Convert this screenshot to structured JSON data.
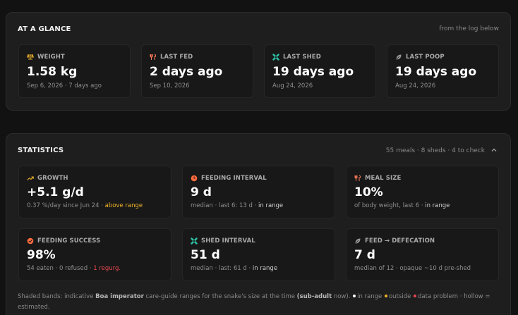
{
  "glance": {
    "title": "AT A GLANCE",
    "note": "from the log below",
    "cards": [
      {
        "icon": "scale-icon",
        "label": "WEIGHT",
        "value": "1.58 kg",
        "sub": "Sep 6, 2026 · 7 days ago"
      },
      {
        "icon": "fork-knife-icon",
        "label": "LAST FED",
        "value": "2 days ago",
        "sub": "Sep 10, 2026"
      },
      {
        "icon": "shed-icon",
        "label": "LAST SHED",
        "value": "19 days ago",
        "sub": "Aug 24, 2026"
      },
      {
        "icon": "leaf-icon",
        "label": "LAST POOP",
        "value": "19 days ago",
        "sub": "Aug 24, 2026"
      }
    ]
  },
  "stats": {
    "title": "STATISTICS",
    "note": "55 meals · 8 sheds · 4 to check",
    "cards": [
      {
        "icon": "trend-up-icon",
        "label": "GROWTH",
        "value": "+5.1 g/d",
        "sub_prefix": "0.37 %/day since Jun 24 · ",
        "sub_status": "above range"
      },
      {
        "icon": "clock-icon",
        "label": "FEEDING INTERVAL",
        "value": "9 d",
        "sub_prefix": "median · last 6: 13 d · ",
        "sub_status": "in range"
      },
      {
        "icon": "fork-knife-icon",
        "label": "MEAL SIZE",
        "value": "10%",
        "sub_prefix": "of body weight, last 6 · ",
        "sub_status": "in range"
      },
      {
        "icon": "check-circle-icon",
        "label": "FEEDING SUCCESS",
        "value": "98%",
        "sub_prefix": "54 eaten · 0 refused · ",
        "sub_status": "1 regurg."
      },
      {
        "icon": "shed-icon",
        "label": "SHED INTERVAL",
        "value": "51 d",
        "sub_prefix": "median · last: 61 d · ",
        "sub_status": "in range"
      },
      {
        "icon": "leaf-icon",
        "label": "FEED → DEFECATION",
        "value": "7 d",
        "sub_prefix": "median of 12 · opaque ~10 d pre-shed",
        "sub_status": ""
      }
    ],
    "footnote": {
      "part1": "Shaded bands: indicative ",
      "species": "Boa imperator",
      "part2": " care-guide ranges for the snake's size at the time ",
      "size_class": "(sub-adult",
      "part3": " now). ",
      "legend_in": "in range",
      "legend_out": "outside",
      "legend_problem": "data problem",
      "part4": " · hollow = estimated."
    }
  },
  "colors": {
    "background": "#121212",
    "panel": "#1e1e1e",
    "card": "#181818",
    "weight_icon": "#f0b429",
    "fed_icon": "#ff7a59",
    "shed_icon": "#2ec4a6",
    "poop_icon": "#9a9a9a",
    "growth_icon": "#f0b429",
    "feeding_interval_icon": "#ff6b3d",
    "success_icon": "#ff6b3d",
    "warn": "#f0b429",
    "bad": "#e5484d",
    "in_range": "#ffffff",
    "outside": "#f0b429",
    "problem": "#e5484d"
  }
}
